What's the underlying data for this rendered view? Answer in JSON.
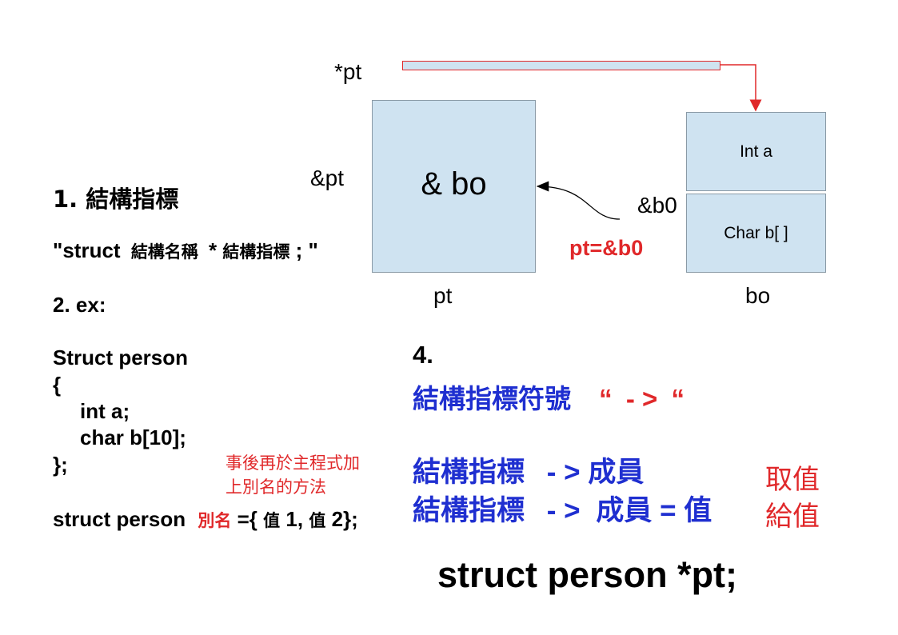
{
  "diagram": {
    "pointer_label": "*pt",
    "address_label": "&pt",
    "pt_box_text": "& bo",
    "pt_caption": "pt",
    "member_a": "Int a",
    "member_b": "Char b[ ]",
    "bo_caption": "bo",
    "b0_address": "&b0",
    "assign_text": "pt=&b0",
    "colors": {
      "box_fill": "#cfe3f1",
      "arrow_red": "#e0282a",
      "blue": "#1f2fd0"
    }
  },
  "left": {
    "title": "1. 結構指標",
    "syntax_prefix": "\"struct",
    "syntax_name": "結構名稱",
    "syntax_star": "*",
    "syntax_ptr": "結構指標",
    "syntax_end": "; \"",
    "ex_label": "2. ex:",
    "code": [
      "Struct person",
      "{",
      "int a;",
      "char b[10];",
      "};"
    ],
    "note_line1": "事後再於主程式加",
    "note_line2": "上別名的方法",
    "decl_prefix": "struct person",
    "decl_alias": "別名",
    "decl_eq": "={",
    "decl_v1": "值",
    "decl_1": "1,",
    "decl_v2": "值",
    "decl_2": "2};"
  },
  "right": {
    "num": "4.",
    "symbol_title": "結構指標符號",
    "symbol_open": "“",
    "symbol_arrow": "- >",
    "symbol_close": "“",
    "row1_ptr": "結構指標",
    "row1_arrow": "- >",
    "row1_member": "成員",
    "row2_ptr": "結構指標",
    "row2_arrow": "- >",
    "row2_member": "成員",
    "row2_eq": "=",
    "row2_val": "值",
    "get_label": "取值",
    "set_label": "給值",
    "declaration": "struct person *pt;"
  }
}
